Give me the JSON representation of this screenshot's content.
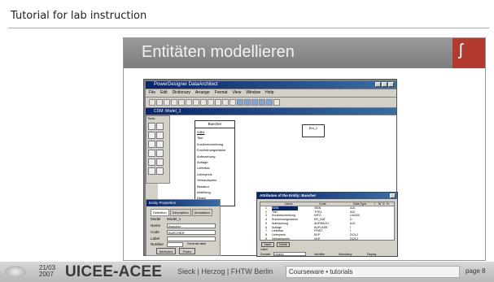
{
  "header": {
    "title": "Tutorial for lab instruction"
  },
  "slide": {
    "title": "Entitäten modellieren"
  },
  "app": {
    "window_title": "PowerDesigner DataArchitect",
    "menu": [
      "File",
      "Edit",
      "Dictionary",
      "Arrange",
      "Format",
      "View",
      "Window",
      "Help"
    ],
    "model_window_title": "CDM: Model_1",
    "palette_title": "Tools",
    "entity": {
      "title": "Buecher",
      "attributes": [
        "ISBN",
        "Titel",
        "Kurzbeschreibung",
        "Erscheinungsdatum",
        "Aufmachung",
        "Auflage",
        "Lieferbar",
        "Lieferpreis",
        "Verkaufspreis",
        "Bestand",
        "Abteilung",
        "Regal"
      ]
    },
    "entity2": {
      "title": "Ent_2"
    },
    "properties": {
      "title": "Entity Properties",
      "tabs": [
        "Definition",
        "Description",
        "Annotation"
      ],
      "model_label": "Model",
      "model_value": "Model_1",
      "name_label": "Name",
      "name_value": "Buecher",
      "code_label": "Code",
      "code_value": "BUECHER",
      "label_label": "Label",
      "number_label": "Number",
      "generate_label": "Generate table",
      "btn_attributes": "Attributes",
      "btn_rules": "Rules"
    },
    "attributes_dialog": {
      "title": "Attributes of the Entity: Buecher",
      "columns": [
        "Name",
        "Code",
        "Data Type",
        "I",
        "M",
        "D",
        "N"
      ],
      "rows": [
        {
          "num": "1",
          "name": "ISBN",
          "code": "ISBN",
          "type": "A15"
        },
        {
          "num": "2",
          "name": "Titel",
          "code": "TITEL",
          "type": "A20"
        },
        {
          "num": "3",
          "name": "Kurzbeschreibung",
          "code": "INFO",
          "type": "LVA200"
        },
        {
          "num": "4",
          "name": "Erscheinungsdatum",
          "code": "ER_DAT",
          "type": "D"
        },
        {
          "num": "5",
          "name": "Aufmachung",
          "code": "AUFMACH",
          "type": "A10"
        },
        {
          "num": "6",
          "name": "Auflage",
          "code": "AUFLAGE",
          "type": "I"
        },
        {
          "num": "7",
          "name": "Lieferbar",
          "code": "FRIST",
          "type": "I"
        },
        {
          "num": "8",
          "name": "Lieferpreis",
          "code": "EKP",
          "type": "DC5,2"
        },
        {
          "num": "9",
          "name": "Verkaufspreis",
          "code": "VKP",
          "type": "DC5,2"
        }
      ],
      "btn_insert": "Insert",
      "btn_delete": "Delete",
      "label_label": "Label",
      "domain_label": "Domain",
      "domain_value": "<None>",
      "identifier_label": "Identifier",
      "mandatory_label": "Mandatory",
      "display_label": "Display",
      "btn_check": "Check",
      "btn_describe": "Describe",
      "btn_annotate": "Annotate",
      "btn_ok": "OK",
      "btn_cancel": "Cancel",
      "btn_help": "Help"
    }
  },
  "footer": {
    "date_top": "21/03",
    "date_bottom": "2007",
    "brand": "UICEE-ACEE",
    "authors": "Sieck | Herzog | FHTW Berlin",
    "course": "Courseware • tutorials",
    "page": "page 8"
  }
}
